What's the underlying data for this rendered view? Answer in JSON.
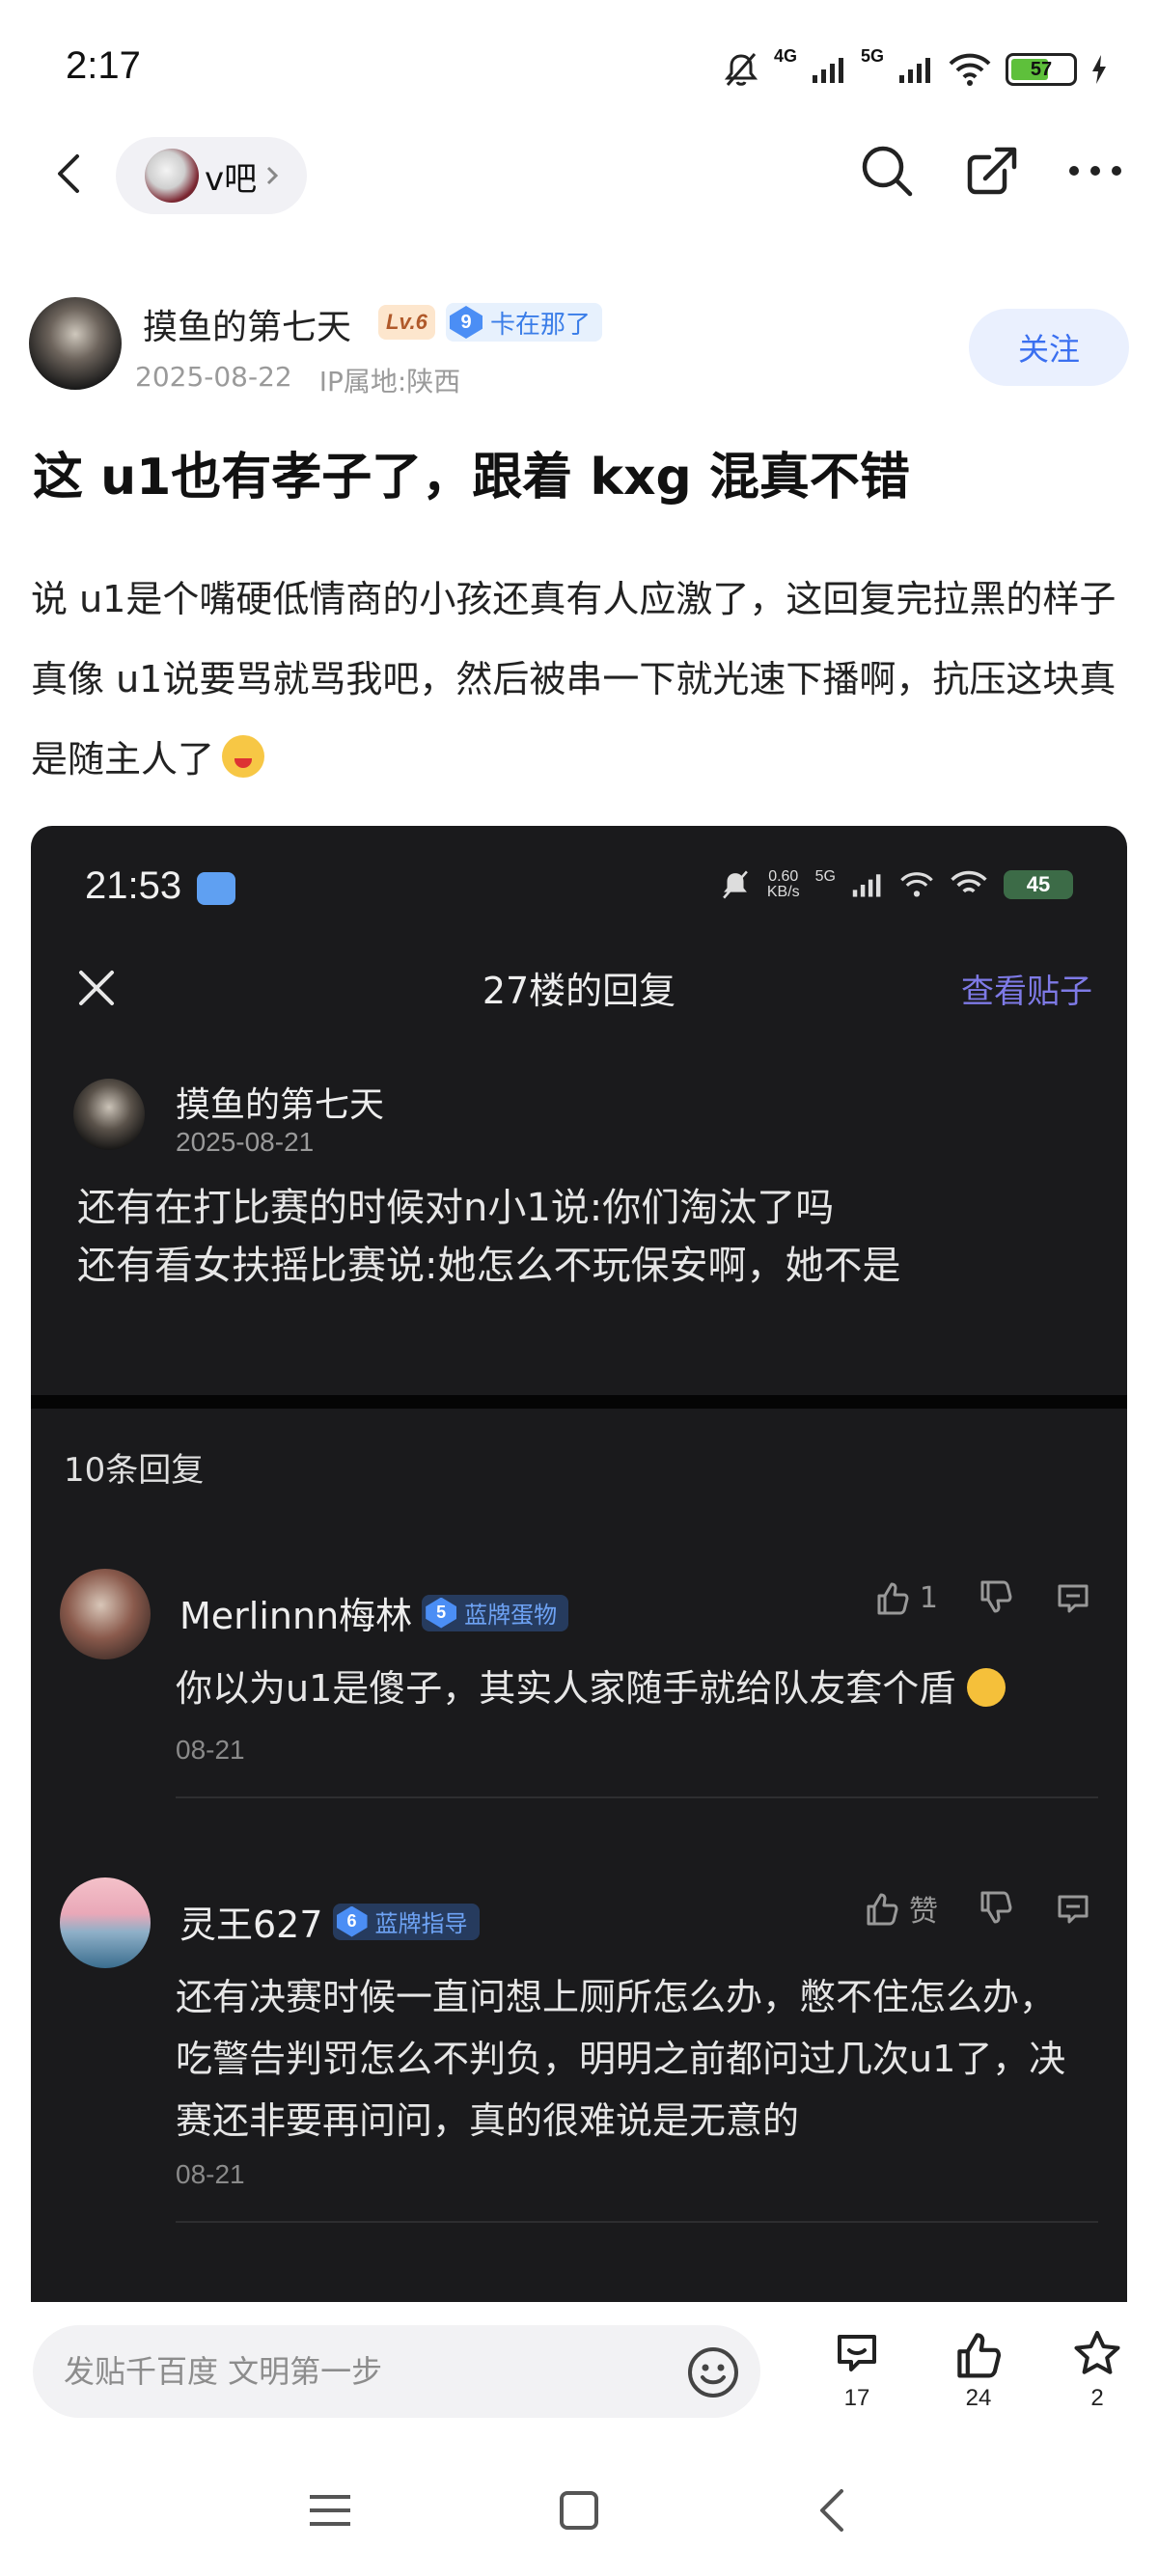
{
  "status_bar": {
    "time": "2:17",
    "network_4g": "4G",
    "network_5g": "5G",
    "battery": "57"
  },
  "nav": {
    "forum_name": "v吧"
  },
  "author": {
    "name": "摸鱼的第七天",
    "level": "Lv.6",
    "title_level": "9",
    "title": "卡在那了",
    "date": "2025-08-22",
    "ip": "IP属地:陕西",
    "follow_label": "关注"
  },
  "post": {
    "title": "这 u1也有孝子了，跟着 kxg 混真不错",
    "body": "说 u1是个嘴硬低情商的小孩还真有人应激了，这回复完拉黑的样子真像 u1说要骂就骂我吧，然后被串一下就光速下播啊，抗压这块真是随主人了"
  },
  "screenshot": {
    "time": "21:53",
    "net_speed": "0.60",
    "net_unit": "KB/s",
    "net_5g": "5G",
    "battery": "45",
    "header_title": "27楼的回复",
    "view_post": "查看贴子",
    "quote": {
      "name": "摸鱼的第七天",
      "date": "2025-08-21",
      "line1": "还有在打比赛的时候对n小1说:你们淘汰了吗",
      "line2": "还有看女扶摇比赛说:她怎么不玩保安啊，她不是"
    },
    "reply_count": "10条回复",
    "replies": [
      {
        "name": "Merlinnn梅林",
        "badge_level": "5",
        "badge_text": "蓝牌蛋物",
        "likes": "1",
        "text": "你以为u1是傻子，其实人家随手就给队友套个盾",
        "date": "08-21"
      },
      {
        "name": "灵王627",
        "badge_level": "6",
        "badge_text": "蓝牌指导",
        "likes": "赞",
        "text": "还有决赛时候一直问想上厕所怎么办，憋不住怎么办，吃警告判罚怎么不判负，明明之前都问过几次u1了，决赛还非要再问问，真的很难说是无意的",
        "date": "08-21"
      }
    ]
  },
  "bottom_bar": {
    "input_placeholder": "发贴千百度 文明第一步",
    "comments": "17",
    "likes": "24",
    "favorites": "2"
  },
  "colors": {
    "accent": "#3a6ff0",
    "dark_bg": "#1a1a1c",
    "link_purple": "#7e7ae6"
  }
}
